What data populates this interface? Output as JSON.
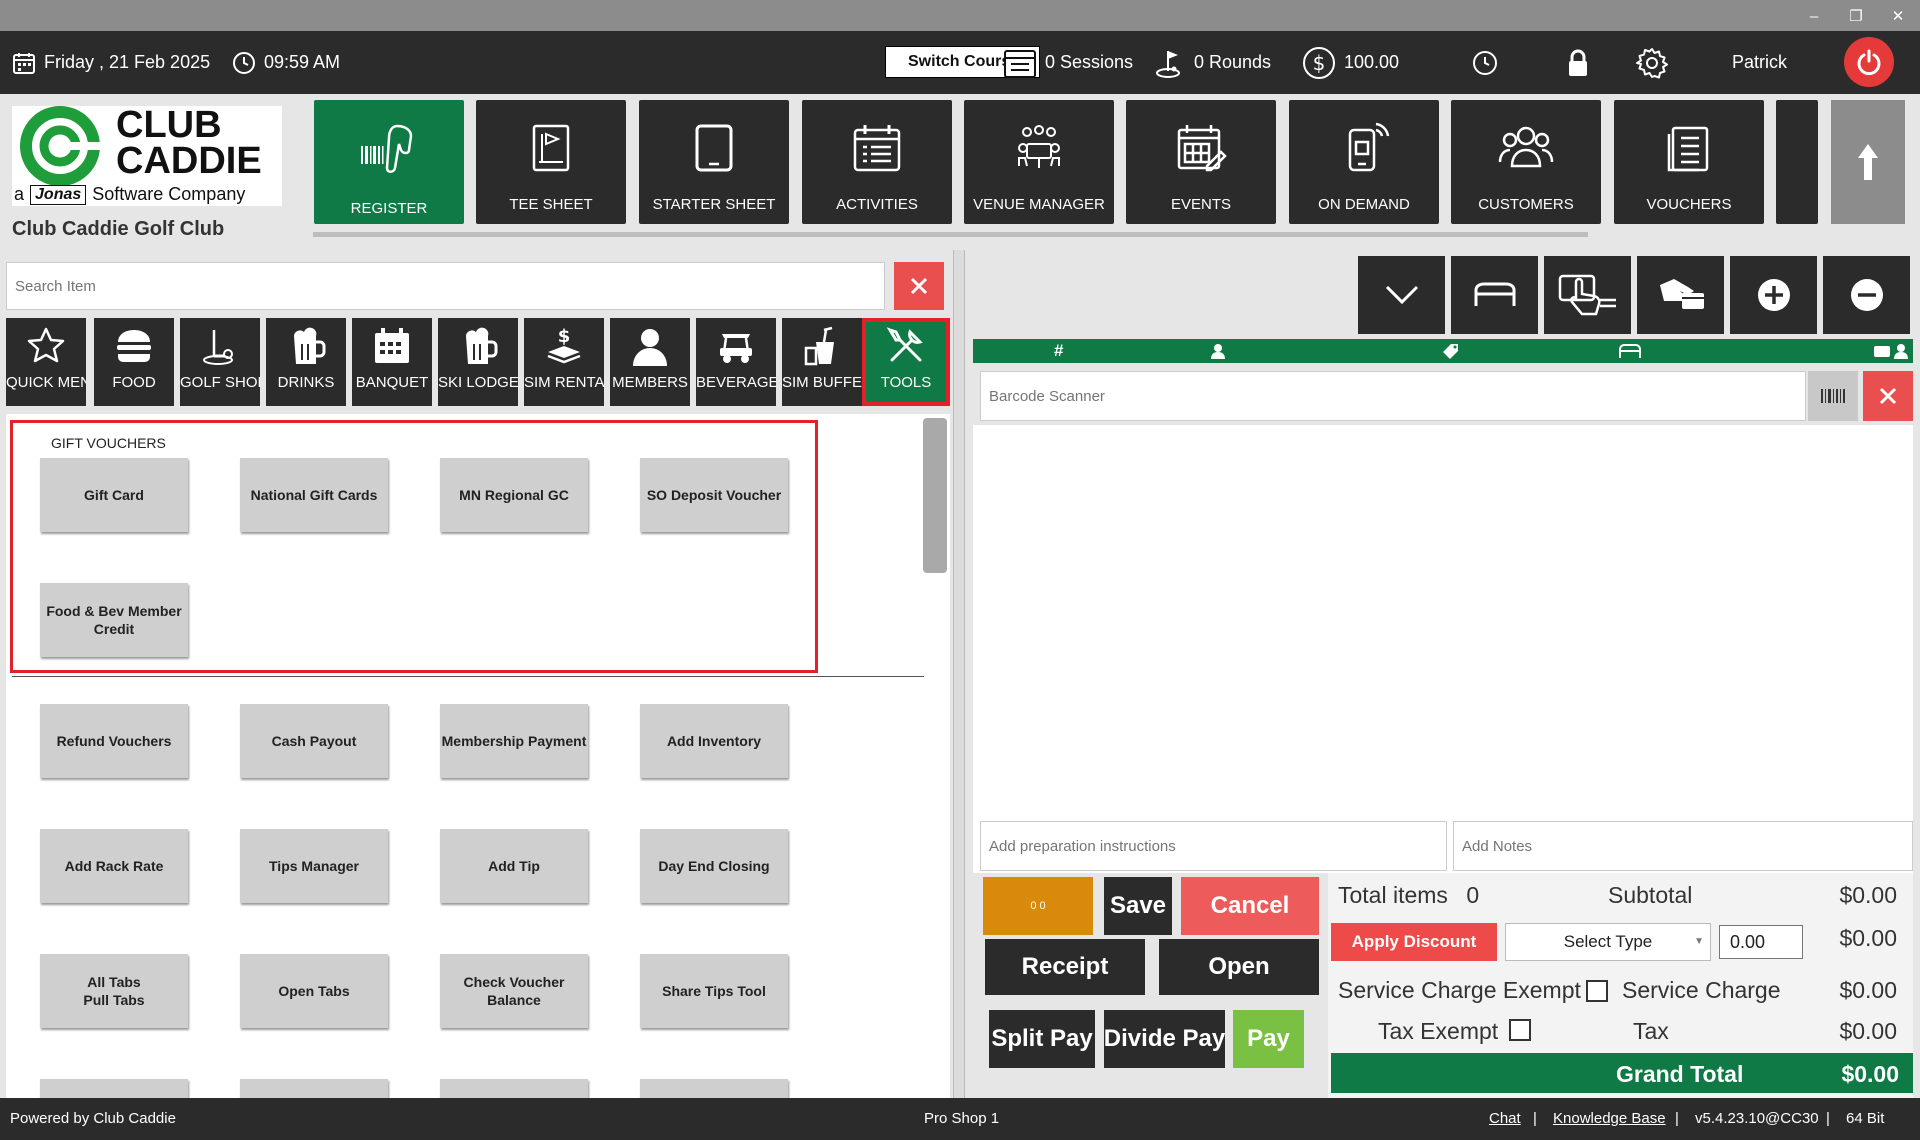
{
  "header": {
    "date": "Friday ,  21 Feb 2025",
    "time": "09:59 AM",
    "switch_course": "Switch Course",
    "sessions": "0 Sessions",
    "rounds": "0 Rounds",
    "balance": "100.00",
    "user": "Patrick"
  },
  "brand": {
    "logo_line1": "CLUB",
    "logo_line2": "CADDIE",
    "logo_tagline_a": "a",
    "logo_tagline_jonas": "Jonas",
    "logo_tagline_rest": "Software Company",
    "club_name": "Club Caddie Golf Club",
    "accent": "#0f7a45",
    "danger": "#e94f4f"
  },
  "nav": [
    {
      "label": "REGISTER",
      "icon": "barcode-scanner-icon"
    },
    {
      "label": "TEE SHEET",
      "icon": "tee-sheet-icon"
    },
    {
      "label": "STARTER SHEET",
      "icon": "tablet-icon"
    },
    {
      "label": "ACTIVITIES",
      "icon": "calendar-list-icon"
    },
    {
      "label": "VENUE MANAGER",
      "icon": "venue-icon"
    },
    {
      "label": "EVENTS",
      "icon": "events-icon"
    },
    {
      "label": "ON DEMAND",
      "icon": "mobile-icon"
    },
    {
      "label": "CUSTOMERS",
      "icon": "customers-icon"
    },
    {
      "label": "VOUCHERS",
      "icon": "voucher-icon"
    }
  ],
  "search": {
    "placeholder": "Search Item"
  },
  "categories": [
    {
      "label": "QUICK MENU"
    },
    {
      "label": "FOOD"
    },
    {
      "label": "GOLF SHOP"
    },
    {
      "label": "DRINKS"
    },
    {
      "label": "BANQUET"
    },
    {
      "label": "SKI LODGE"
    },
    {
      "label": "SIM RENTAL"
    },
    {
      "label": "MEMBERS"
    },
    {
      "label": "BEVERAGE"
    },
    {
      "label": "SIM BUFFET"
    },
    {
      "label": "TOOLS"
    }
  ],
  "gift_vouchers": {
    "title": "GIFT VOUCHERS",
    "items": [
      "Gift Card",
      "National Gift Cards",
      "MN Regional GC",
      "SO Deposit Voucher",
      "Food & Bev Member\nCredit"
    ]
  },
  "tools": {
    "items": [
      "Refund Vouchers",
      "Cash Payout",
      "Membership Payment",
      "Add Inventory",
      "Add Rack Rate",
      "Tips Manager",
      "Add Tip",
      "Day End Closing",
      "All Tabs\nPull Tabs",
      "Open Tabs",
      "Check Voucher\nBalance",
      "Share Tips Tool"
    ]
  },
  "order": {
    "header_hash": "#",
    "barcode_placeholder": "Barcode Scanner",
    "prep_placeholder": "Add preparation instructions",
    "notes_placeholder": "Add Notes",
    "counter": "0  0"
  },
  "actions": {
    "save": "Save",
    "cancel": "Cancel",
    "receipt": "Receipt",
    "open": "Open",
    "split_pay": "Split Pay",
    "divide_pay": "Divide Pay",
    "pay": "Pay",
    "apply_discount": "Apply Discount",
    "select_type": "Select Type",
    "discount_value": "0.00"
  },
  "totals": {
    "total_items_label": "Total items",
    "total_items": "0",
    "subtotal_label": "Subtotal",
    "subtotal": "$0.00",
    "discount": "$0.00",
    "service_exempt_label": "Service Charge Exempt",
    "service_charge_label": "Service Charge",
    "service_charge": "$0.00",
    "tax_exempt_label": "Tax Exempt",
    "tax_label": "Tax",
    "tax": "$0.00",
    "grand_total_label": "Grand Total",
    "grand_total": "$0.00"
  },
  "footer": {
    "powered": "Powered by Club Caddie",
    "location": "Pro Shop 1",
    "chat": "Chat",
    "kb": "Knowledge Base",
    "version": "v5.4.23.10@CC30",
    "bits": "64 Bit",
    "sep": "|"
  }
}
